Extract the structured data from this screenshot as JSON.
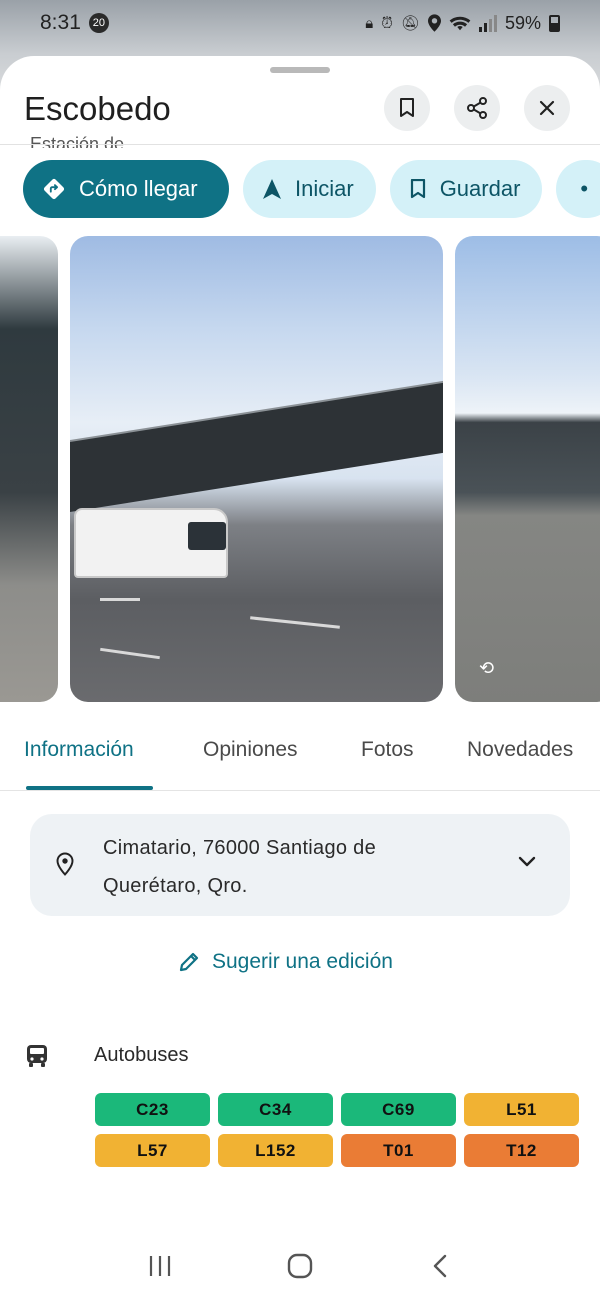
{
  "status_bar": {
    "time": "8:31",
    "notification_count": "20",
    "battery": "59%",
    "icons": [
      "lock-icon",
      "alarm-icon",
      "mute-icon",
      "location-icon",
      "wifi-icon",
      "signal-icon",
      "battery-icon"
    ]
  },
  "header": {
    "title": "Escobedo",
    "peek_text": "Estación de ...",
    "buttons": [
      "bookmark-icon",
      "share-icon",
      "close-icon"
    ]
  },
  "actions": [
    {
      "label": "Cómo llegar",
      "icon": "directions-icon",
      "style": "primary"
    },
    {
      "label": "Iniciar",
      "icon": "navigation-arrow-icon",
      "style": "secondary"
    },
    {
      "label": "Guardar",
      "icon": "bookmark-icon",
      "style": "secondary"
    }
  ],
  "tabs": [
    {
      "label": "Información",
      "active": true
    },
    {
      "label": "Opiniones",
      "active": false
    },
    {
      "label": "Fotos",
      "active": false
    },
    {
      "label": "Novedades",
      "active": false
    }
  ],
  "address": {
    "line1": "Cimatario, 76000 Santiago de",
    "line2": "Querétaro, Qro."
  },
  "suggest_edit": "Sugerir una edición",
  "transit": {
    "label": "Autobuses",
    "routes": [
      {
        "code": "C23",
        "color": "#1bb87a"
      },
      {
        "code": "C34",
        "color": "#1bb87a"
      },
      {
        "code": "C69",
        "color": "#1bb87a"
      },
      {
        "code": "L51",
        "color": "#f1b233"
      },
      {
        "code": "L57",
        "color": "#f1b233"
      },
      {
        "code": "L152",
        "color": "#f1b233"
      },
      {
        "code": "T01",
        "color": "#ea7c35"
      },
      {
        "code": "T12",
        "color": "#ea7c35"
      }
    ]
  },
  "colors": {
    "accent": "#0f7285",
    "chip_secondary_bg": "#d4f1f8"
  }
}
